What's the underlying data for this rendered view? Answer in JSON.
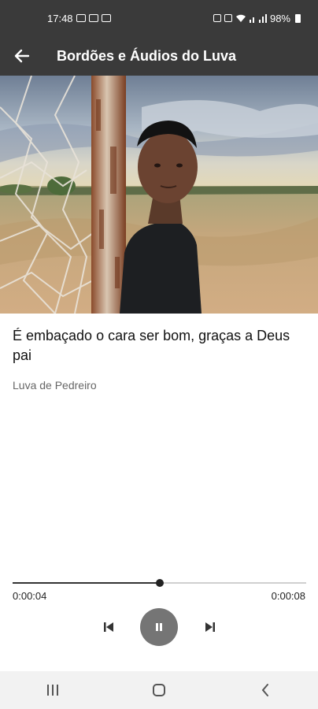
{
  "status_bar": {
    "time": "17:48",
    "battery": "98%"
  },
  "app_bar": {
    "title": "Bordões e Áudios do Luva",
    "back_icon": "arrow-back-icon"
  },
  "track": {
    "title": "É embaçado o cara ser bom, graças a Deus pai",
    "artist": "Luva de Pedreiro",
    "progress_fraction": 0.5,
    "elapsed": "0:00:04",
    "total": "0:00:08",
    "state": "playing"
  },
  "controls": {
    "previous_icon": "skip-previous-icon",
    "pause_icon": "pause-icon",
    "next_icon": "skip-next-icon"
  },
  "nav_bar": {
    "recents_icon": "recents-icon",
    "home_icon": "home-icon",
    "back_icon": "back-chevron-icon"
  },
  "colors": {
    "app_bar": "#3a3a3a",
    "pause_button": "#757575",
    "progress_played": "#333333",
    "progress_remaining": "#d0d0d0"
  }
}
